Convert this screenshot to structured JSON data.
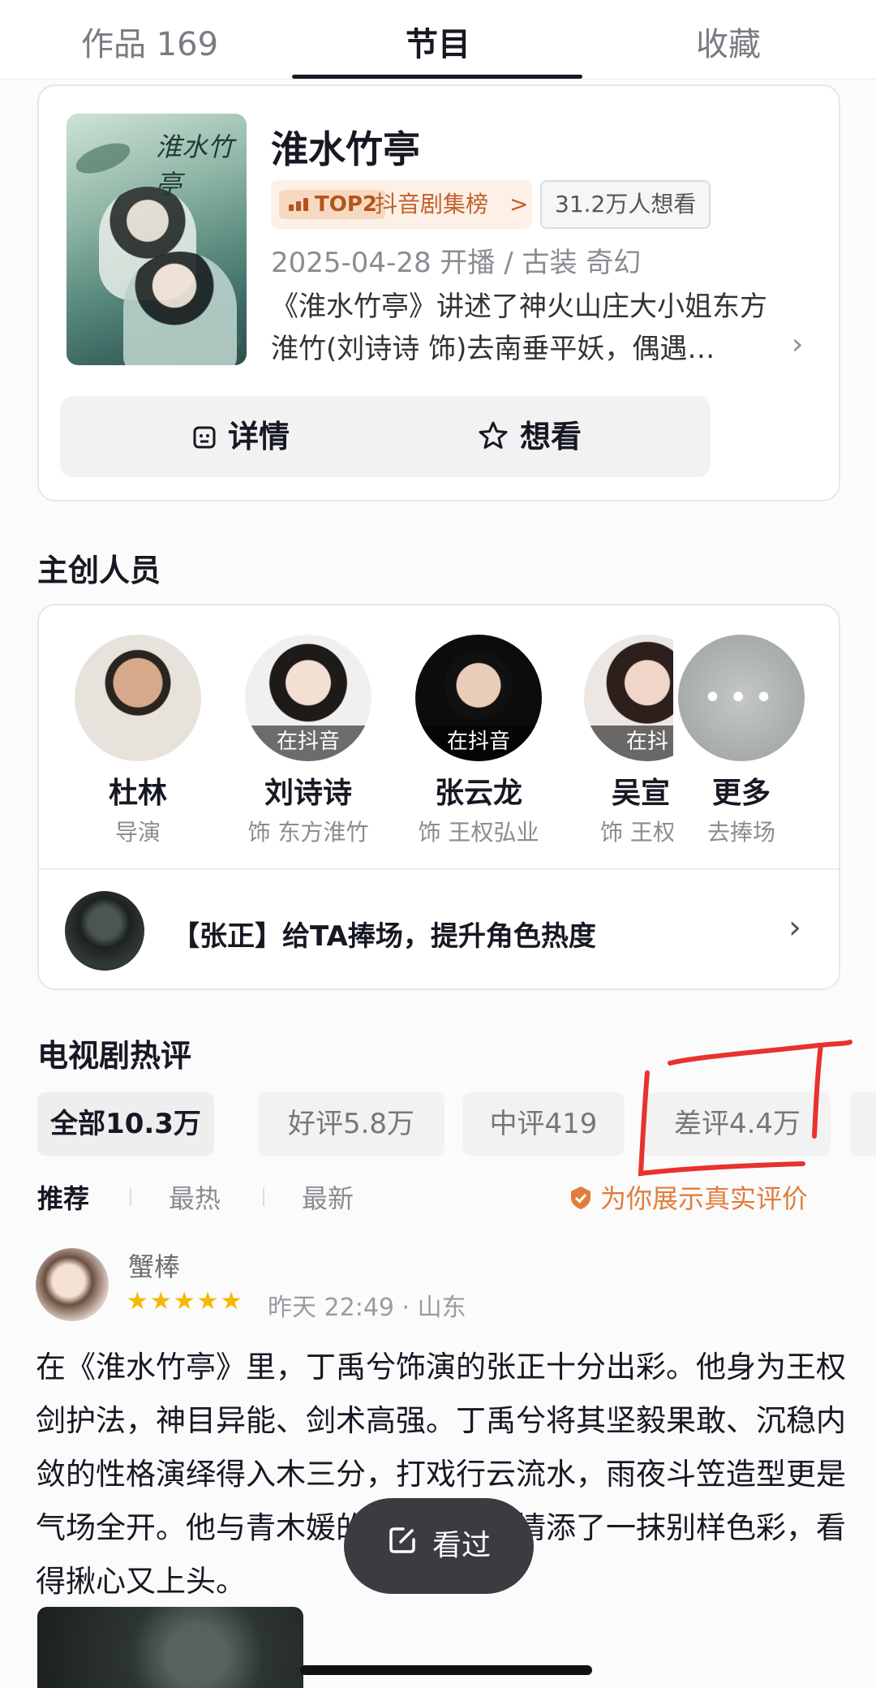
{
  "tabs": [
    {
      "label": "作品 169"
    },
    {
      "label": "节目"
    },
    {
      "label": "收藏"
    }
  ],
  "show": {
    "poster_title": "淮水竹亭",
    "title": "淮水竹亭",
    "rank_tag": "TOP2",
    "rank_label": "抖音剧集榜",
    "rank_chevron": ">",
    "want_count": "31.2万人想看",
    "meta": "2025-04-28 开播 / 古装 奇幻",
    "description": "《淮水竹亭》讲述了神火山庄大小姐东方淮竹(刘诗诗 饰)去南垂平妖，偶遇…",
    "details_button": "详情",
    "want_button": "想看"
  },
  "crew_section": {
    "title": "主创人员",
    "members": [
      {
        "name": "杜林",
        "role": "导演",
        "tag": ""
      },
      {
        "name": "刘诗诗",
        "role": "饰 东方淮竹",
        "tag": "在抖音"
      },
      {
        "name": "张云龙",
        "role": "饰 王权弘业",
        "tag": "在抖音"
      },
      {
        "name": "吴宣",
        "role": "饰 王权",
        "tag": "在抖"
      },
      {
        "name": "更多",
        "role": "去捧场",
        "tag": ""
      }
    ],
    "boost_text": "【张正】给TA捧场，提升角色热度",
    "boost_chevron": "›"
  },
  "reviews": {
    "title": "电视剧热评",
    "filters": [
      {
        "label": "全部10.3万"
      },
      {
        "label": "好评5.8万"
      },
      {
        "label": "中评419"
      },
      {
        "label": "差评4.4万"
      }
    ],
    "sort": [
      {
        "label": "推荐"
      },
      {
        "label": "最热"
      },
      {
        "label": "最新"
      }
    ],
    "authentic_note": "为你展示真实评价",
    "item": {
      "user": "蟹棒",
      "stars": "★★★★★",
      "rating": 5,
      "time_location": "昨天 22:49 · 山东",
      "body": "在《淮水竹亭》里，丁禹兮饰演的张正十分出彩。他身为王权剑护法，神目异能、剑术高强。丁禹兮将其坚毅果敢、沉稳内敛的性格演绎得入木三分，打戏行云流水，雨夜斗笠造型更是气场全开。他与青木媛的虐恋，给剧情添了一抹别样色彩，看得揪心又上头。"
    }
  },
  "floating_button": {
    "label": "看过"
  },
  "colors": {
    "accent": "#161823",
    "rank_orange": "#c2612b",
    "star": "#f5b800",
    "annotation_red": "#e8322e"
  },
  "icons": {
    "details": "calendar-icon",
    "want": "star-outline-icon",
    "boost": "chevron-right-icon",
    "seen": "edit-icon",
    "authentic": "shield-check-icon"
  }
}
